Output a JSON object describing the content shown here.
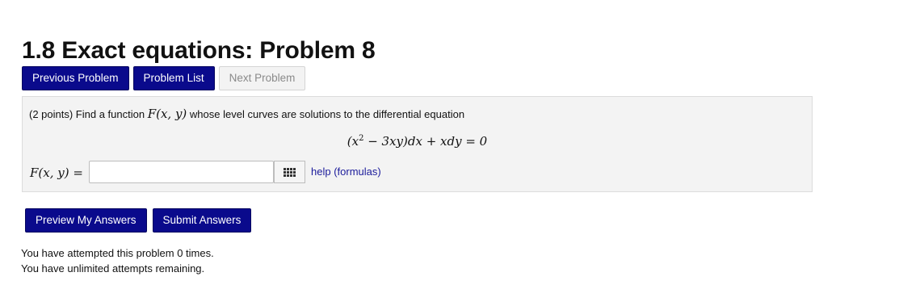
{
  "page": {
    "title": "1.8 Exact equations: Problem 8"
  },
  "nav": {
    "previous_label": "Previous Problem",
    "list_label": "Problem List",
    "next_label": "Next Problem"
  },
  "problem": {
    "points": "(2 points) Find a function",
    "function": "F(x, y)",
    "prompt_rest": "whose level curves are solutions to the differential equation",
    "eq_part1": "(x",
    "eq_exponent": "2",
    "eq_part2": " − 3xy)dx + xdy = 0",
    "answer_label": "F(x, y) =",
    "answer_value": "",
    "help_label": "help (formulas)"
  },
  "actions": {
    "preview_label": "Preview My Answers",
    "submit_label": "Submit Answers"
  },
  "status": {
    "attempts": "You have attempted this problem 0 times.",
    "remaining": "You have unlimited attempts remaining."
  },
  "colors": {
    "primary_button": "#0a0a8c",
    "panel_background": "#f3f3f3",
    "link": "#1a1a9a"
  },
  "icons": {
    "equation_editor": "grid-icon"
  }
}
